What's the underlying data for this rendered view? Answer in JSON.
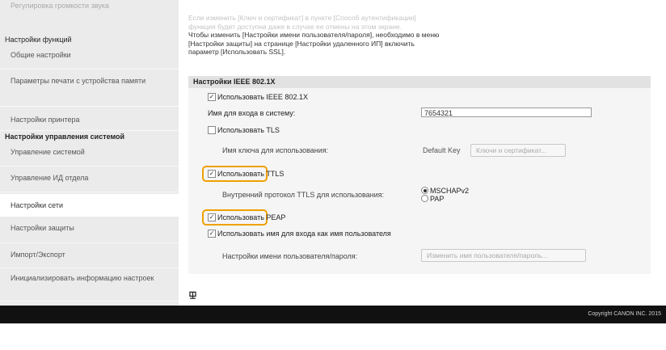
{
  "sidebar": {
    "top_faded": "Регулировка громкости звука",
    "function_settings_header": "Настройки функций",
    "items_a": [
      "Общие настройки",
      "Параметры печати с устройства памяти",
      "Настройки принтера"
    ],
    "mgmt_header": "Настройки управления системой",
    "items_b": [
      "Управление системой",
      "Управление ИД отдела",
      "Настройки сети",
      "Настройки защиты",
      "Импорт/Экспорт",
      "Инициализировать информацию настроек"
    ]
  },
  "note": {
    "line1": "Если изменить [Ключ и сертификат] в пункте [Способ аутентификации]",
    "line2": "функция будет доступна даже в случае ее отмены на этом экране.",
    "line3": "Чтобы изменить [Настройки имени пользователя/пароля], необходимо в меню",
    "line4": "[Настройки защиты] на странице [Настройки удаленного ИП] включить",
    "line5": "параметр [Использовать SSL]."
  },
  "ieee": {
    "header": "Настройки IEEE 802.1X",
    "use_ieee_label": "Использовать IEEE 802.1X",
    "login_label": "Имя для входа в систему:",
    "login_value": "7654321",
    "use_tls_label": "Использовать TLS",
    "key_name_label": "Имя ключа для использования:",
    "default_key_label": "Default Key",
    "key_cert_button": "Ключи и сертификат...",
    "use_ttls_label": "Использовать TTLS",
    "ttls_protocol_label": "Внутренний протокол TTLS для использования:",
    "mschap_label": "MSCHAPv2",
    "pap_label": "PAP",
    "use_peap_label": "Использовать PEAP",
    "use_login_as_user_label": "Использовать имя для входа как имя пользователя",
    "user_pass_settings_label": "Настройки имени пользователя/пароля:",
    "change_user_button": "Изменить имя пользователя/пароль..."
  },
  "footer": {
    "to_top": "⯶",
    "copyright": "Copyright CANON INC. 2015"
  },
  "state": {
    "use_ieee": true,
    "use_tls": false,
    "use_ttls": true,
    "use_peap": true,
    "use_login_as_user": true,
    "ttls_protocol": "MSCHAPv2"
  },
  "colors": {
    "sidebar_bg": "#ebebeb",
    "highlight": "#f0a000",
    "footer_bg": "#111111"
  }
}
